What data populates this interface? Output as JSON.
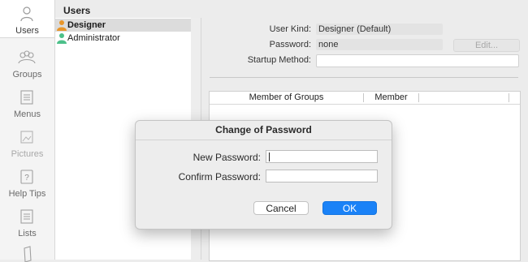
{
  "sidebar": {
    "items": [
      {
        "label": "Users",
        "icon": "user-icon"
      },
      {
        "label": "Groups",
        "icon": "groups-icon"
      },
      {
        "label": "Menus",
        "icon": "menus-icon"
      },
      {
        "label": "Pictures",
        "icon": "pictures-icon"
      },
      {
        "label": "Help Tips",
        "icon": "help-tips-icon"
      },
      {
        "label": "Lists",
        "icon": "lists-icon"
      },
      {
        "label": "",
        "icon": "document-icon"
      }
    ]
  },
  "users_panel": {
    "title": "Users",
    "users": [
      {
        "name": "Designer",
        "selected": true,
        "icon_color": "#e8962a"
      },
      {
        "name": "Administrator",
        "selected": false,
        "icon_color": "#4cc08a"
      }
    ]
  },
  "details": {
    "user_kind_label": "User Kind:",
    "user_kind_value": "Designer (Default)",
    "password_label": "Password:",
    "password_value": "none",
    "edit_button": "Edit...",
    "startup_method_label": "Startup Method:",
    "startup_method_value": ""
  },
  "groups_table": {
    "columns": [
      "Member of Groups",
      "Member"
    ]
  },
  "dialog": {
    "title": "Change of Password",
    "new_password_label": "New Password:",
    "new_password_value": "",
    "confirm_password_label": "Confirm Password:",
    "confirm_password_value": "",
    "cancel_label": "Cancel",
    "ok_label": "OK"
  },
  "colors": {
    "accent": "#1a82f7",
    "designer_icon": "#e8962a",
    "administrator_icon": "#4cc08a"
  }
}
